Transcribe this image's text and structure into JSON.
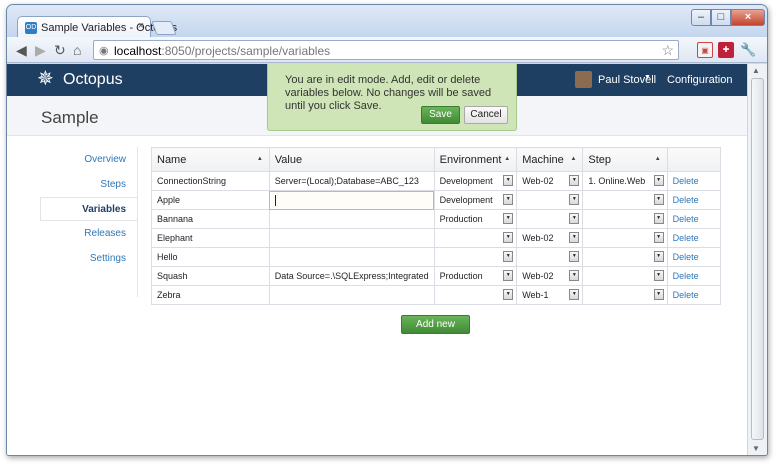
{
  "browser": {
    "tab_title": "Sample Variables - Octopus",
    "favicon_label": "OD",
    "tab_close": "×",
    "url_host": "localhost",
    "url_path": ":8050/projects/sample/variables",
    "win_min": "–",
    "win_max": "□",
    "win_close": "×"
  },
  "appbar": {
    "logo_text": "Octopus",
    "user_name": "Paul Stovell",
    "configuration_label": "Configuration"
  },
  "banner": {
    "message": "You are in edit mode. Add, edit or delete variables below. No changes will be saved until you click Save.",
    "save_label": "Save",
    "cancel_label": "Cancel"
  },
  "page": {
    "title": "Sample"
  },
  "sidenav": {
    "items": [
      {
        "label": "Overview",
        "active": false
      },
      {
        "label": "Steps",
        "active": false
      },
      {
        "label": "Variables",
        "active": true
      },
      {
        "label": "Releases",
        "active": false
      },
      {
        "label": "Settings",
        "active": false
      }
    ]
  },
  "grid": {
    "columns": [
      "Name",
      "Value",
      "Environment",
      "Machine",
      "Step"
    ],
    "rows": [
      {
        "name": "ConnectionString",
        "value": "Server=(Local);Database=ABC_123",
        "environment": "Development",
        "machine": "Web-02",
        "step": "1. Online.Web",
        "action": "Delete"
      },
      {
        "name": "Apple",
        "value": "",
        "environment": "Development",
        "machine": "",
        "step": "",
        "action": "Delete"
      },
      {
        "name": "Bannana",
        "value": "",
        "environment": "Production",
        "machine": "",
        "step": "",
        "action": "Delete"
      },
      {
        "name": "Elephant",
        "value": "",
        "environment": "",
        "machine": "Web-02",
        "step": "",
        "action": "Delete"
      },
      {
        "name": "Hello",
        "value": "",
        "environment": "",
        "machine": "",
        "step": "",
        "action": "Delete"
      },
      {
        "name": "Squash",
        "value": "Data Source=.\\SQLExpress;Integrated",
        "environment": "Production",
        "machine": "Web-02",
        "step": "",
        "action": "Delete"
      },
      {
        "name": "Zebra",
        "value": "",
        "environment": "",
        "machine": "Web-1",
        "step": "",
        "action": "Delete"
      }
    ],
    "add_new_label": "Add new"
  },
  "colors": {
    "appbar": "#1f3f62",
    "banner": "#cfe5b7",
    "primary_button": "#4f9c43",
    "link": "#2f77b8"
  }
}
